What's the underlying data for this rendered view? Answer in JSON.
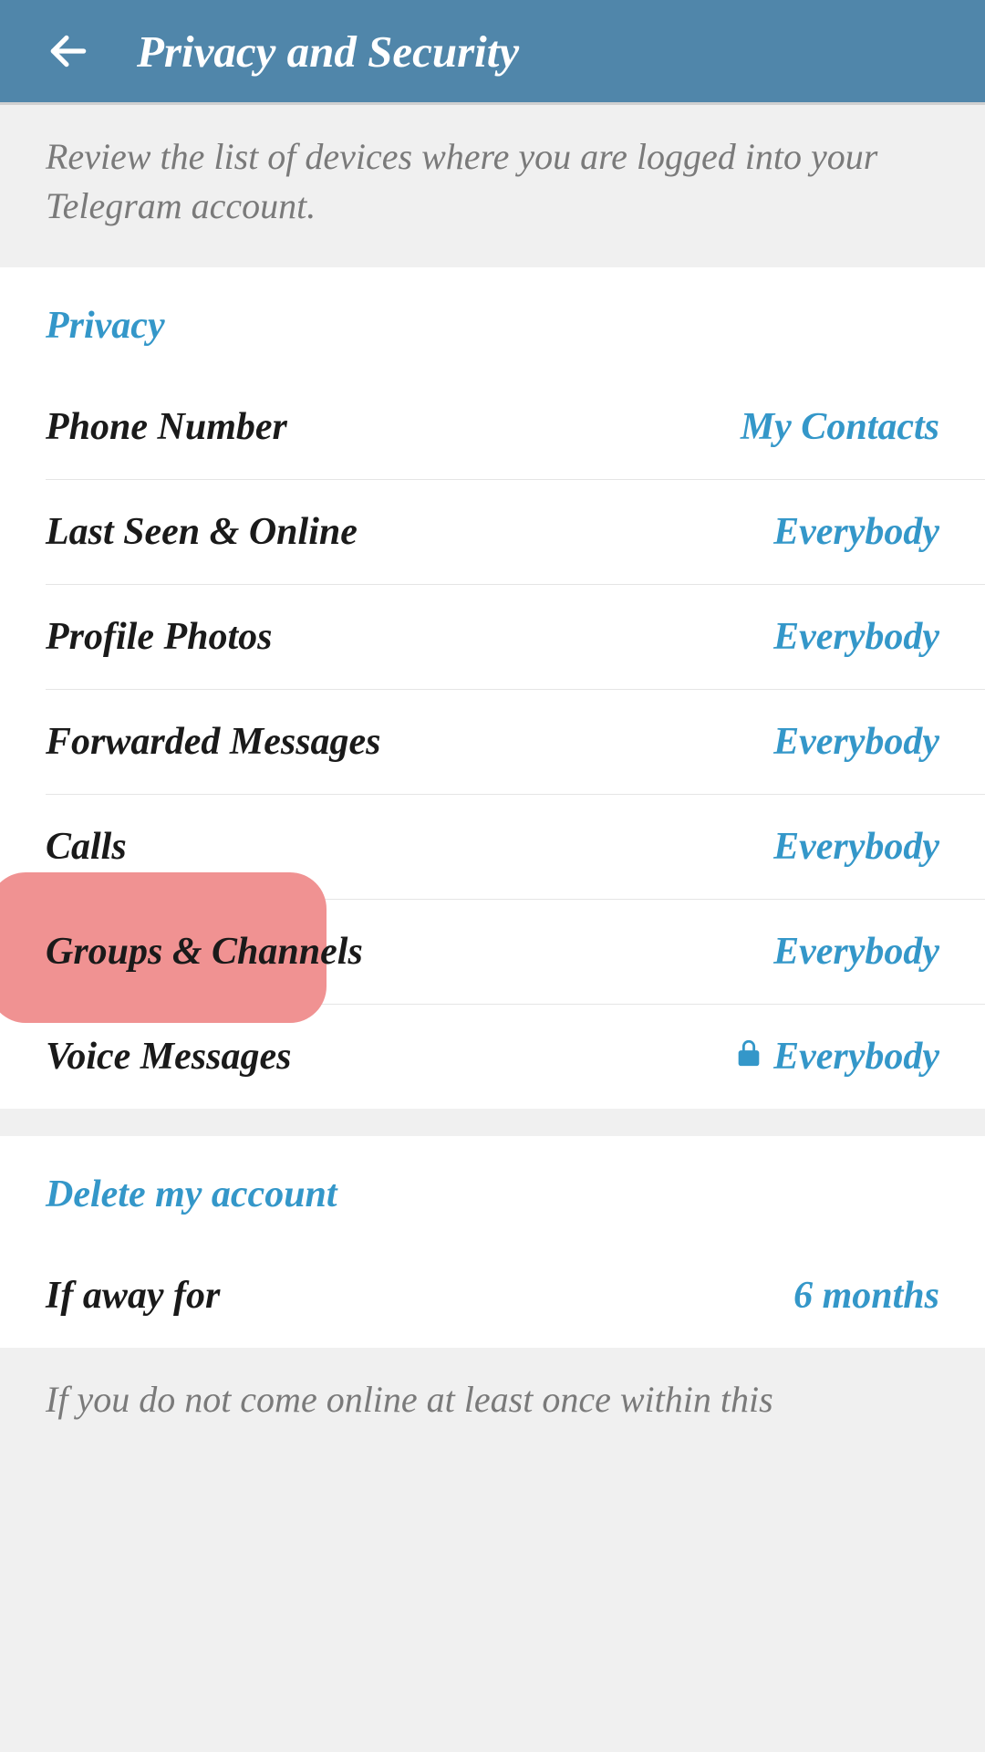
{
  "header": {
    "title": "Privacy and Security"
  },
  "info_devices": "Review the list of devices where you are logged into your Telegram account.",
  "sections": {
    "privacy": {
      "title": "Privacy",
      "items": [
        {
          "label": "Phone Number",
          "value": "My Contacts"
        },
        {
          "label": "Last Seen & Online",
          "value": "Everybody"
        },
        {
          "label": "Profile Photos",
          "value": "Everybody"
        },
        {
          "label": "Forwarded Messages",
          "value": "Everybody"
        },
        {
          "label": "Calls",
          "value": "Everybody"
        },
        {
          "label": "Groups & Channels",
          "value": "Everybody"
        },
        {
          "label": "Voice Messages",
          "value": "Everybody",
          "locked": true
        }
      ]
    },
    "delete": {
      "title": "Delete my account",
      "items": [
        {
          "label": "If away for",
          "value": "6 months"
        }
      ]
    }
  },
  "info_delete": "If you do not come online at least once within this"
}
